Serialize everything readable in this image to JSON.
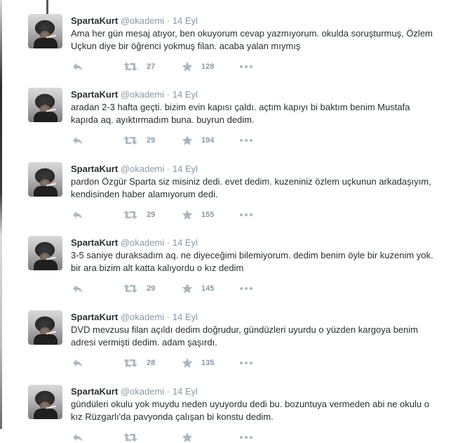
{
  "timeline": {
    "tweets": [
      {
        "name": "SpartaKurt",
        "handle": "@okademi",
        "time": "14 Eyl",
        "text": "Ama her gün mesaj atıyor, ben okuyorum cevap yazmıyorum. okulda soruşturmuş, Özlem Uçkun diye bir öğrenci yokmuş filan. acaba yalan mıymış",
        "retweets": "27",
        "favorites": "128"
      },
      {
        "name": "SpartaKurt",
        "handle": "@okademi",
        "time": "14 Eyl",
        "text": "aradan 2-3 hafta geçti. bizim evin kapısı çaldı. açtım kapıyı bi baktım benim Mustafa kapıda aq.  ayıktırmadım buna. buyrun dedim.",
        "retweets": "29",
        "favorites": "194"
      },
      {
        "name": "SpartaKurt",
        "handle": "@okademi",
        "time": "14 Eyl",
        "text": "pardon Özgür Sparta siz misiniz dedi. evet dedim. kuzeniniz özlem uçkunun arkadaşıyım, kendisinden haber alamıyorum dedi.",
        "retweets": "29",
        "favorites": "155"
      },
      {
        "name": "SpartaKurt",
        "handle": "@okademi",
        "time": "14 Eyl",
        "text": "3-5 saniye duraksadım aq. ne diyeceğimi bilemiyorum. dedim benim öyle bir kuzenim yok. bir ara bizim alt katta kalıyordu o kız dedim",
        "retweets": "29",
        "favorites": "145"
      },
      {
        "name": "SpartaKurt",
        "handle": "@okademi",
        "time": "14 Eyl",
        "text": "DVD mevzusu filan açıldı dedim doğrudur, gündüzleri uyurdu o yüzden kargoya benim adresi vermişti dedim. adam şaşırdı.",
        "retweets": "28",
        "favorites": "135"
      },
      {
        "name": "SpartaKurt",
        "handle": "@okademi",
        "time": "14 Eyl",
        "text": "gündüleri okulu yok muydu neden uyuyordu dedi bu. bozuntuya vermeden abi ne okulu o kız Rüzgarlı'da pavyonda çalışan bi konstu dedim.",
        "retweets": "",
        "favorites": ""
      }
    ],
    "separator": "·",
    "icons": {
      "reply": "reply-icon",
      "retweet": "retweet-icon",
      "favorite": "star-icon",
      "more": "more-icon"
    },
    "colors": {
      "text": "#292f33",
      "muted": "#8899a6",
      "icon": "#aab8c2",
      "background": "#ffffff"
    }
  }
}
